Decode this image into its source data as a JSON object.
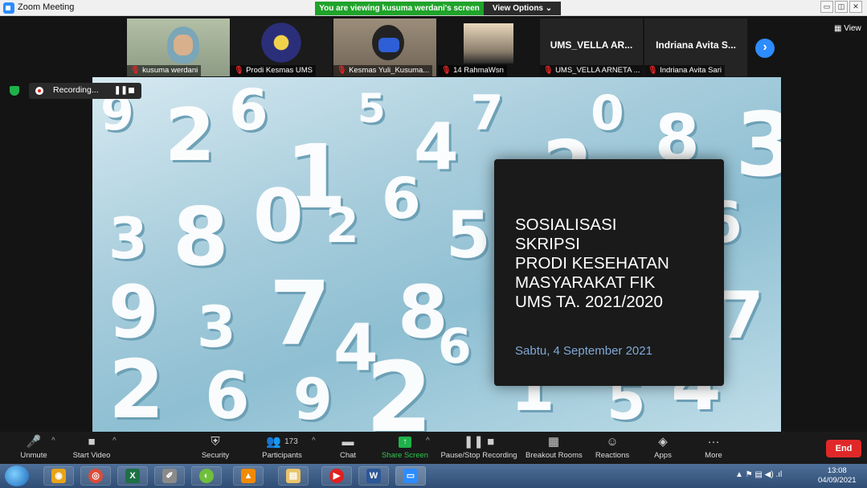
{
  "window": {
    "title": "Zoom Meeting",
    "share_banner": "You are viewing kusuma werdani's screen",
    "view_options": "View Options ⌄",
    "min": "▭",
    "max": "◫",
    "close": "✕"
  },
  "thumbnails": [
    {
      "name": "kusuma werdani",
      "mic": "muted"
    },
    {
      "name": "Prodi Kesmas UMS",
      "mic": "muted"
    },
    {
      "name": "Kesmas Yuli_Kusuma...",
      "mic": "muted"
    },
    {
      "name": "14 RahmaWsn",
      "mic": "muted"
    },
    {
      "display": "UMS_VELLA AR...",
      "name": "UMS_VELLA ARNETA ...",
      "mic": "muted"
    },
    {
      "display": "Indriana Avita S...",
      "name": "Indriana Avita Sari",
      "mic": "muted"
    }
  ],
  "strip": {
    "next_icon": "›",
    "view_label": "▦ View"
  },
  "recording": {
    "label": "Recording...",
    "pause": "❚❚"
  },
  "slide": {
    "title_lines": [
      "SOSIALISASI",
      "SKRIPSI",
      "PRODI KESEHATAN",
      "MASYARAKAT FIK",
      "UMS TA. 2021/2020"
    ],
    "date": "Sabtu, 4 September 2021"
  },
  "background_numbers": [
    "9",
    "2",
    "6",
    "1",
    "5",
    "4",
    "7",
    "3",
    "8",
    "0",
    "2",
    "6",
    "5",
    "9",
    "3",
    "7",
    "4",
    "8",
    "2",
    "6"
  ],
  "toolbar": {
    "unmute": "Unmute",
    "start_video": "Start Video",
    "security": "Security",
    "participants": "Participants",
    "participants_count": "173",
    "chat": "Chat",
    "share_screen": "Share Screen",
    "pause_stop_recording": "Pause/Stop Recording",
    "breakout_rooms": "Breakout Rooms",
    "reactions": "Reactions",
    "apps": "Apps",
    "more": "More",
    "end": "End",
    "icons": {
      "unmute": "🎤",
      "start_video": "■",
      "security": "⛨",
      "participants": "👥",
      "chat": "▬",
      "share": "↑",
      "recording": "❚❚ ■",
      "breakout": "▦",
      "reactions": "☺",
      "apps": "◈",
      "more": "···"
    }
  },
  "taskbar": {
    "apps": [
      "◉",
      "◎",
      "X",
      "✐",
      "◐",
      "▲",
      "▤",
      "▶",
      "W",
      "▭"
    ],
    "tray": "▲  ⚑  ▤  ◀)  .ıl",
    "time": "13:08",
    "date": "04/09/2021"
  },
  "colors": {
    "accent_blue": "#2d8cff",
    "share_green": "#1fa32a",
    "end_red": "#e02828",
    "slide_date": "#7fa9d6"
  }
}
